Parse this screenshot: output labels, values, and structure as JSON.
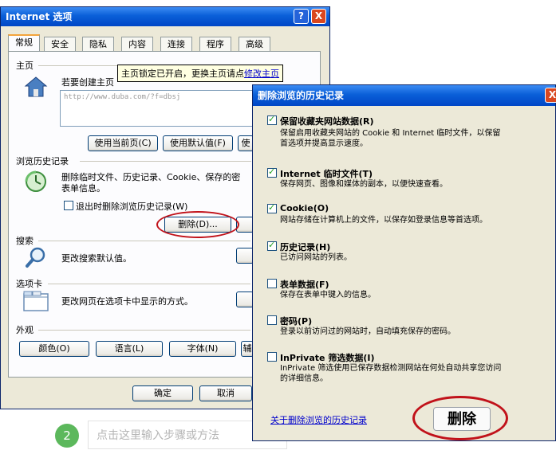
{
  "options_dialog": {
    "title": "Internet 选项",
    "help_label": "?",
    "close_label": "X",
    "tabs": [
      {
        "label": "常规",
        "active": true
      },
      {
        "label": "安全"
      },
      {
        "label": "隐私"
      },
      {
        "label": "内容"
      },
      {
        "label": "连接"
      },
      {
        "label": "程序"
      },
      {
        "label": "高级"
      }
    ],
    "homepage": {
      "group_label": "主页",
      "description": "若要创建主页",
      "url_value": "http://www.duba.com/?f=dbsj",
      "tooltip_text": "主页锁定已开启，更换主页请点",
      "tooltip_link": "修改主页",
      "use_current": "使用当前页(C)",
      "use_default": "使用默认值(F)",
      "use_blank_partial": "使"
    },
    "history": {
      "group_label": "浏览历史记录",
      "description_line1": "删除临时文件、历史记录、Cookie、保存的密",
      "description_line2": "表单信息。",
      "exit_delete_label": "退出时删除浏览历史记录(W)",
      "delete_button": "删除(D)..."
    },
    "search": {
      "group_label": "搜索",
      "description": "更改搜索默认值。"
    },
    "tabs_section": {
      "group_label": "选项卡",
      "description": "更改网页在选项卡中显示的方式。"
    },
    "appearance": {
      "group_label": "外观",
      "colors": "颜色(O)",
      "languages": "语言(L)",
      "fonts": "字体(N)",
      "accessibility_partial": "辅"
    },
    "ok": "确定",
    "cancel": "取消"
  },
  "delete_history_dialog": {
    "title": "删除浏览的历史记录",
    "close_label": "X",
    "items": [
      {
        "label": "保留收藏夹网站数据(R)",
        "checked": true,
        "desc": [
          "保留启用收藏夹网站的 Cookie 和 Internet 临时文件，以保留",
          "首选项并提高显示速度。"
        ]
      },
      {
        "label": "Internet 临时文件(T)",
        "checked": true,
        "desc": [
          "保存网页、图像和媒体的副本，以便快速查看。"
        ]
      },
      {
        "label": "Cookie(O)",
        "checked": true,
        "desc": [
          "网站存储在计算机上的文件，以保存如登录信息等首选项。"
        ]
      },
      {
        "label": "历史记录(H)",
        "checked": true,
        "desc": [
          "已访问网站的列表。"
        ]
      },
      {
        "label": "表单数据(F)",
        "checked": false,
        "desc": [
          "保存在表单中键入的信息。"
        ]
      },
      {
        "label": "密码(P)",
        "checked": false,
        "desc": [
          "登录以前访问过的网站时，自动填充保存的密码。"
        ]
      },
      {
        "label": "InPrivate 筛选数据(I)",
        "checked": false,
        "desc": [
          "InPrivate 筛选使用已保存数据检测网站在何处自动共享您访问",
          "的详细信息。"
        ]
      }
    ],
    "about_link": "关于删除浏览的历史记录",
    "delete_button": "删除"
  },
  "step": {
    "number": "2",
    "placeholder": "点击这里输入步骤或方法"
  },
  "colors": {
    "title_blue": "#0a5fd8",
    "annotation_red": "#c1121a",
    "step_green": "#5cb85c"
  }
}
